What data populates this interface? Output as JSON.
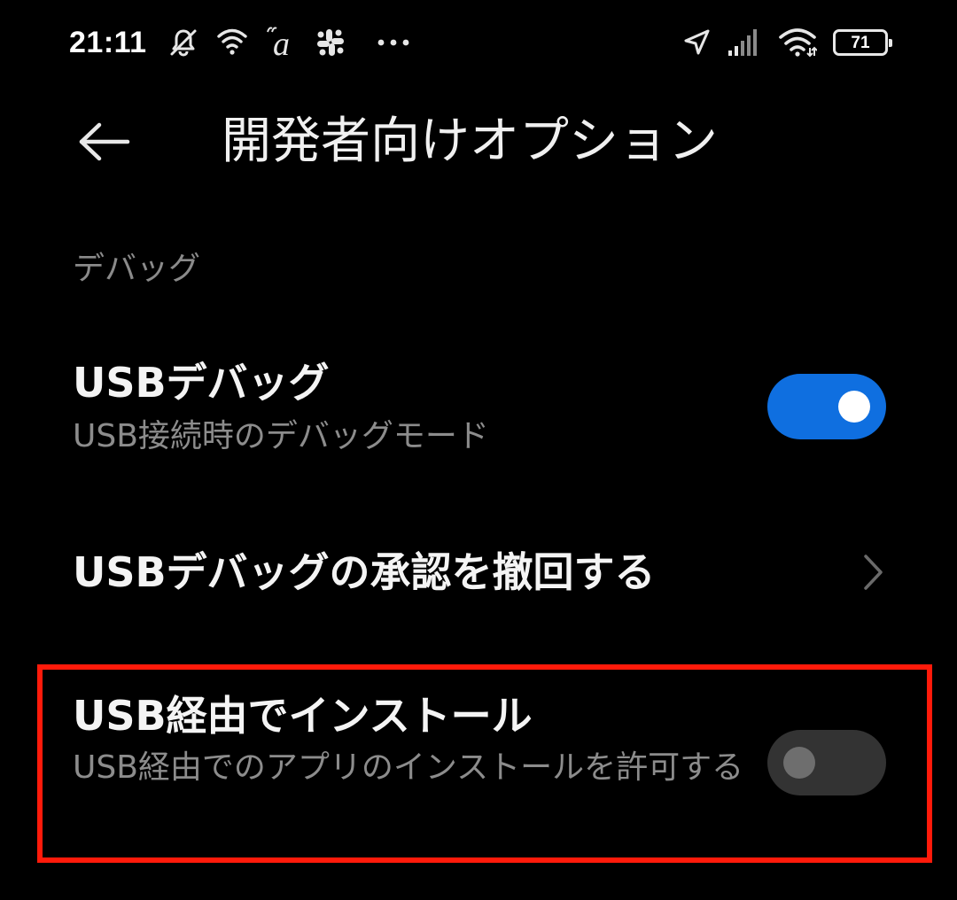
{
  "status_bar": {
    "time": "21:11",
    "battery_level": "71",
    "left_icons": [
      "bell-muted-icon",
      "wifi-calling-icon",
      "a-app-icon",
      "slack-icon",
      "more-dots-icon"
    ],
    "right_icons": [
      "location-arrow-icon",
      "signal-icon",
      "wifi-icon",
      "battery-icon"
    ],
    "a_glyph": "a"
  },
  "header": {
    "title": "開発者向けオプション",
    "back_icon": "arrow-left-icon"
  },
  "section": {
    "title": "デバッグ"
  },
  "settings": {
    "usb_debugging": {
      "title": "USBデバッグ",
      "subtitle": "USB接続時のデバッグモード",
      "enabled": true
    },
    "revoke_authorizations": {
      "title": "USBデバッグの承認を撤回する",
      "icon": "chevron-right-icon"
    },
    "install_via_usb": {
      "title": "USB経由でインストール",
      "subtitle": "USB経由でのアプリのインストールを許可する",
      "enabled": false
    }
  },
  "colors": {
    "background": "#000000",
    "toggle_on": "#0f6fe0",
    "toggle_off": "#333333",
    "highlight": "#ff1a0a",
    "secondary_text": "#8c8c8c"
  }
}
